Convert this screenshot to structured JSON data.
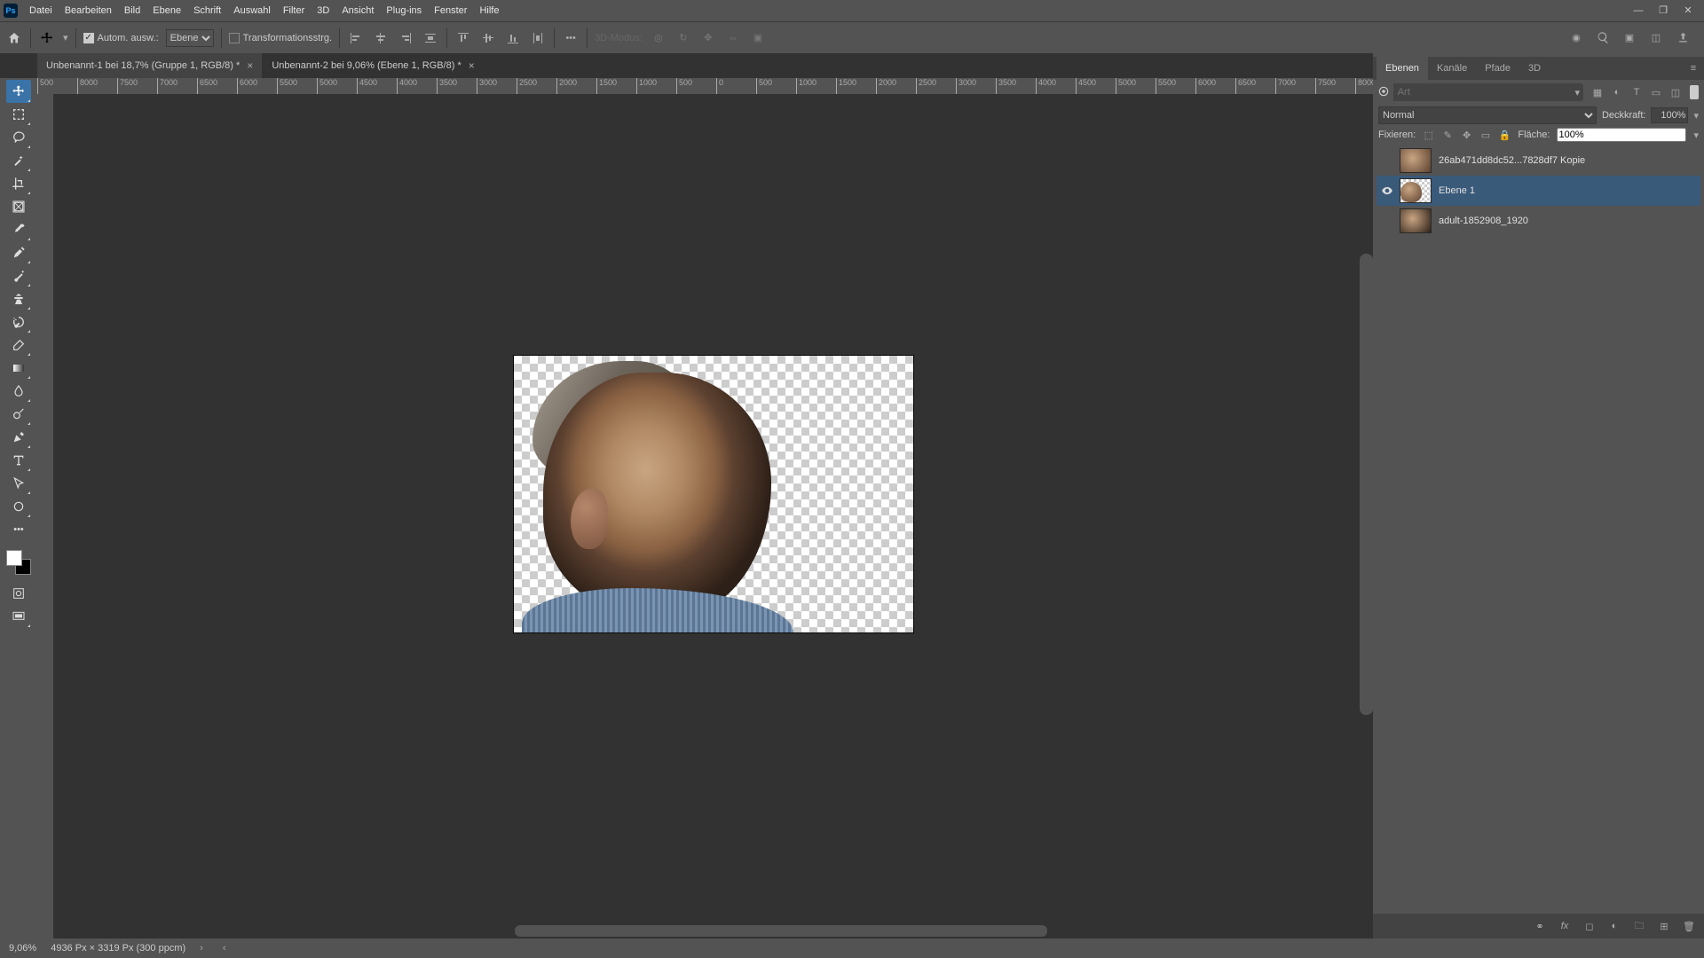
{
  "app": {
    "logo_text": "Ps"
  },
  "menu": {
    "items": [
      {
        "label": "Datei"
      },
      {
        "label": "Bearbeiten"
      },
      {
        "label": "Bild"
      },
      {
        "label": "Ebene"
      },
      {
        "label": "Schrift"
      },
      {
        "label": "Auswahl"
      },
      {
        "label": "Filter"
      },
      {
        "label": "3D"
      },
      {
        "label": "Ansicht"
      },
      {
        "label": "Plug-ins"
      },
      {
        "label": "Fenster"
      },
      {
        "label": "Hilfe"
      }
    ]
  },
  "options": {
    "auto_select_checked": true,
    "auto_select_label": "Autom. ausw.:",
    "auto_select_target": "Ebene",
    "transform_checked": false,
    "transform_label": "Transformationsstrg.",
    "mode3d_label": "3D-Modus:"
  },
  "tabs": [
    {
      "title": "Unbenannt-1 bei 18,7% (Gruppe 1, RGB/8) *",
      "active": false
    },
    {
      "title": "Unbenannt-2 bei 9,06% (Ebene 1, RGB/8) *",
      "active": true
    }
  ],
  "ruler_h": [
    "500",
    "8000",
    "7500",
    "7000",
    "6500",
    "6000",
    "5500",
    "5000",
    "4500",
    "4000",
    "3500",
    "3000",
    "2500",
    "2000",
    "1500",
    "1000",
    "500",
    "0",
    "500",
    "1000",
    "1500",
    "2000",
    "2500",
    "3000",
    "3500",
    "4000",
    "4500",
    "5000",
    "5500",
    "6000",
    "6500",
    "7000",
    "7500",
    "8000"
  ],
  "panels": {
    "layers": {
      "tabs": [
        {
          "label": "Ebenen",
          "active": true
        },
        {
          "label": "Kanäle",
          "active": false
        },
        {
          "label": "Pfade",
          "active": false
        },
        {
          "label": "3D",
          "active": false
        }
      ],
      "filter_placeholder": "Art",
      "blend_mode": "Normal",
      "opacity_label": "Deckkraft:",
      "opacity_value": "100%",
      "lock_label": "Fixieren:",
      "fill_label": "Fläche:",
      "fill_value": "100%",
      "layers": [
        {
          "visible": false,
          "name": "26ab471dd8dc52...7828df7 Kopie",
          "selected": false
        },
        {
          "visible": true,
          "name": "Ebene 1",
          "selected": true
        },
        {
          "visible": false,
          "name": "adult-1852908_1920",
          "selected": false
        }
      ]
    }
  },
  "status": {
    "zoom": "9,06%",
    "doc_info": "4936 Px × 3319 Px (300 ppcm)"
  },
  "colors": {
    "bg_main": "#323232",
    "bg_panel": "#535353",
    "bg_tab": "#434343",
    "accent": "#3a73a8"
  }
}
